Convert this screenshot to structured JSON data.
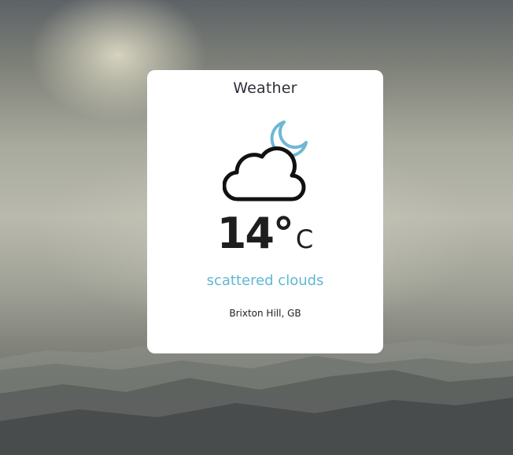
{
  "card": {
    "title": "Weather",
    "icon": "cloud-moon-icon",
    "temperature": "14°",
    "unit": "C",
    "description": "scattered clouds",
    "location": "Brixton Hill, GB"
  },
  "colors": {
    "accent": "#5fb8d3",
    "card_background": "#ffffff",
    "text": "#1e1e1e"
  }
}
